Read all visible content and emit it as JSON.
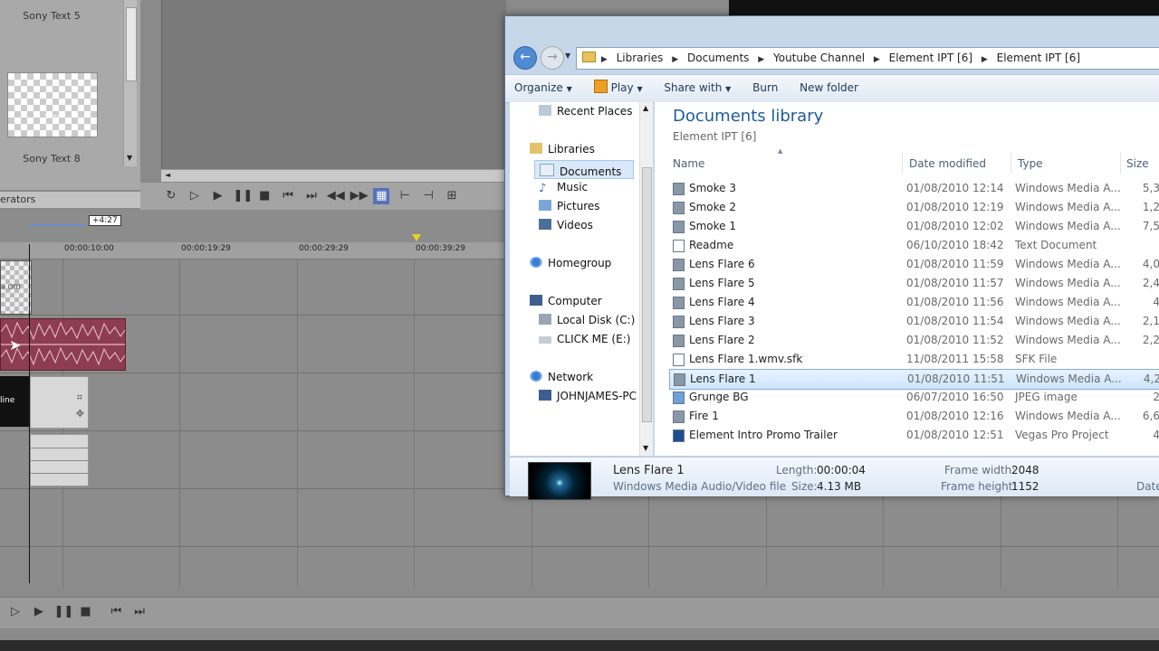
{
  "vegas": {
    "media_items": [
      "Sony Text 5",
      "Sony Text 8"
    ],
    "thumb_caption": "Sony",
    "generators_tab": "erators",
    "ruler_marker": "+4:27",
    "timecodes": [
      "00:00:10:00",
      "00:00:19:29",
      "00:00:29:29",
      "00:00:39:29"
    ],
    "video_event_text": "a Offl",
    "dark_event_text": "line"
  },
  "explorer": {
    "breadcrumb": [
      "Libraries",
      "Documents",
      "Youtube Channel",
      "Element IPT [6]",
      "Element IPT [6]"
    ],
    "toolbar": {
      "organize": "Organize",
      "play": "Play",
      "share_with": "Share with",
      "burn": "Burn",
      "new_folder": "New folder"
    },
    "nav": {
      "recent_places": "Recent Places",
      "libraries": "Libraries",
      "documents": "Documents",
      "music": "Music",
      "pictures": "Pictures",
      "videos": "Videos",
      "homegroup": "Homegroup",
      "computer": "Computer",
      "local_disk": "Local Disk (C:)",
      "click_me": "CLICK ME (E:)",
      "network": "Network",
      "johnjames": "JOHNJAMES-PC"
    },
    "library_title": "Documents library",
    "library_subtitle": "Element IPT [6]",
    "columns": {
      "name": "Name",
      "date": "Date modified",
      "type": "Type",
      "size": "Size"
    },
    "files": [
      {
        "name": "Smoke 3",
        "date": "01/08/2010 12:14",
        "type": "Windows Media A...",
        "size": "5,3"
      },
      {
        "name": "Smoke 2",
        "date": "01/08/2010 12:19",
        "type": "Windows Media A...",
        "size": "1,2"
      },
      {
        "name": "Smoke 1",
        "date": "01/08/2010 12:02",
        "type": "Windows Media A...",
        "size": "7,5"
      },
      {
        "name": "Readme",
        "date": "06/10/2010 18:42",
        "type": "Text Document",
        "size": ""
      },
      {
        "name": "Lens Flare 6",
        "date": "01/08/2010 11:59",
        "type": "Windows Media A...",
        "size": "4,0"
      },
      {
        "name": "Lens Flare 5",
        "date": "01/08/2010 11:57",
        "type": "Windows Media A...",
        "size": "2,4"
      },
      {
        "name": "Lens Flare 4",
        "date": "01/08/2010 11:56",
        "type": "Windows Media A...",
        "size": "4"
      },
      {
        "name": "Lens Flare 3",
        "date": "01/08/2010 11:54",
        "type": "Windows Media A...",
        "size": "2,1"
      },
      {
        "name": "Lens Flare 2",
        "date": "01/08/2010 11:52",
        "type": "Windows Media A...",
        "size": "2,2"
      },
      {
        "name": "Lens Flare 1.wmv.sfk",
        "date": "11/08/2011 15:58",
        "type": "SFK File",
        "size": ""
      },
      {
        "name": "Lens Flare 1",
        "date": "01/08/2010 11:51",
        "type": "Windows Media A...",
        "size": "4,2"
      },
      {
        "name": "Grunge BG",
        "date": "06/07/2010 16:50",
        "type": "JPEG image",
        "size": "2"
      },
      {
        "name": "Fire 1",
        "date": "01/08/2010 12:16",
        "type": "Windows Media A...",
        "size": "6,6"
      },
      {
        "name": "Element Intro Promo Trailer",
        "date": "01/08/2010 12:51",
        "type": "Vegas Pro Project",
        "size": "4"
      }
    ],
    "details": {
      "name": "Lens Flare 1",
      "kind": "Windows Media Audio/Video file",
      "length_label": "Length:",
      "length": "00:00:04",
      "size_label": "Size:",
      "size": "4.13 MB",
      "frame_width_label": "Frame width:",
      "frame_width": "2048",
      "frame_height_label": "Frame height:",
      "frame_height": "1152",
      "date_label": "Date"
    }
  }
}
